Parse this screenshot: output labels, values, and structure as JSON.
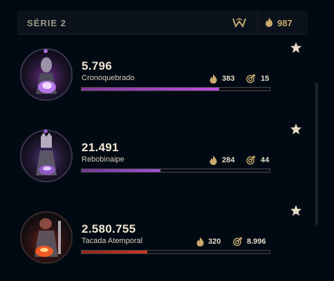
{
  "header": {
    "title": "SÉRIE 2",
    "emblem_icon": "crest-icon",
    "total_icon": "flame-icon",
    "total_points": "987"
  },
  "colors": {
    "gold": "#c8aa6e",
    "purple": "#c04ee0",
    "red": "#d0341e",
    "star": "#e7dcc3"
  },
  "entries": [
    {
      "score": "5.796",
      "name": "Cronoquebrado",
      "points": "383",
      "target_value": "15",
      "progress": 0.73,
      "accent": "#c04ee0",
      "favorite_icon": "star-icon"
    },
    {
      "score": "21.491",
      "name": "Rebobinaipe",
      "points": "284",
      "target_value": "44",
      "progress": 0.42,
      "accent": "#a24fd6",
      "favorite_icon": "star-icon"
    },
    {
      "score": "2.580.755",
      "name": "Tacada Atemporal",
      "points": "320",
      "target_value": "8.996",
      "progress": 0.35,
      "accent": "#d0341e",
      "favorite_icon": "star-icon"
    }
  ]
}
